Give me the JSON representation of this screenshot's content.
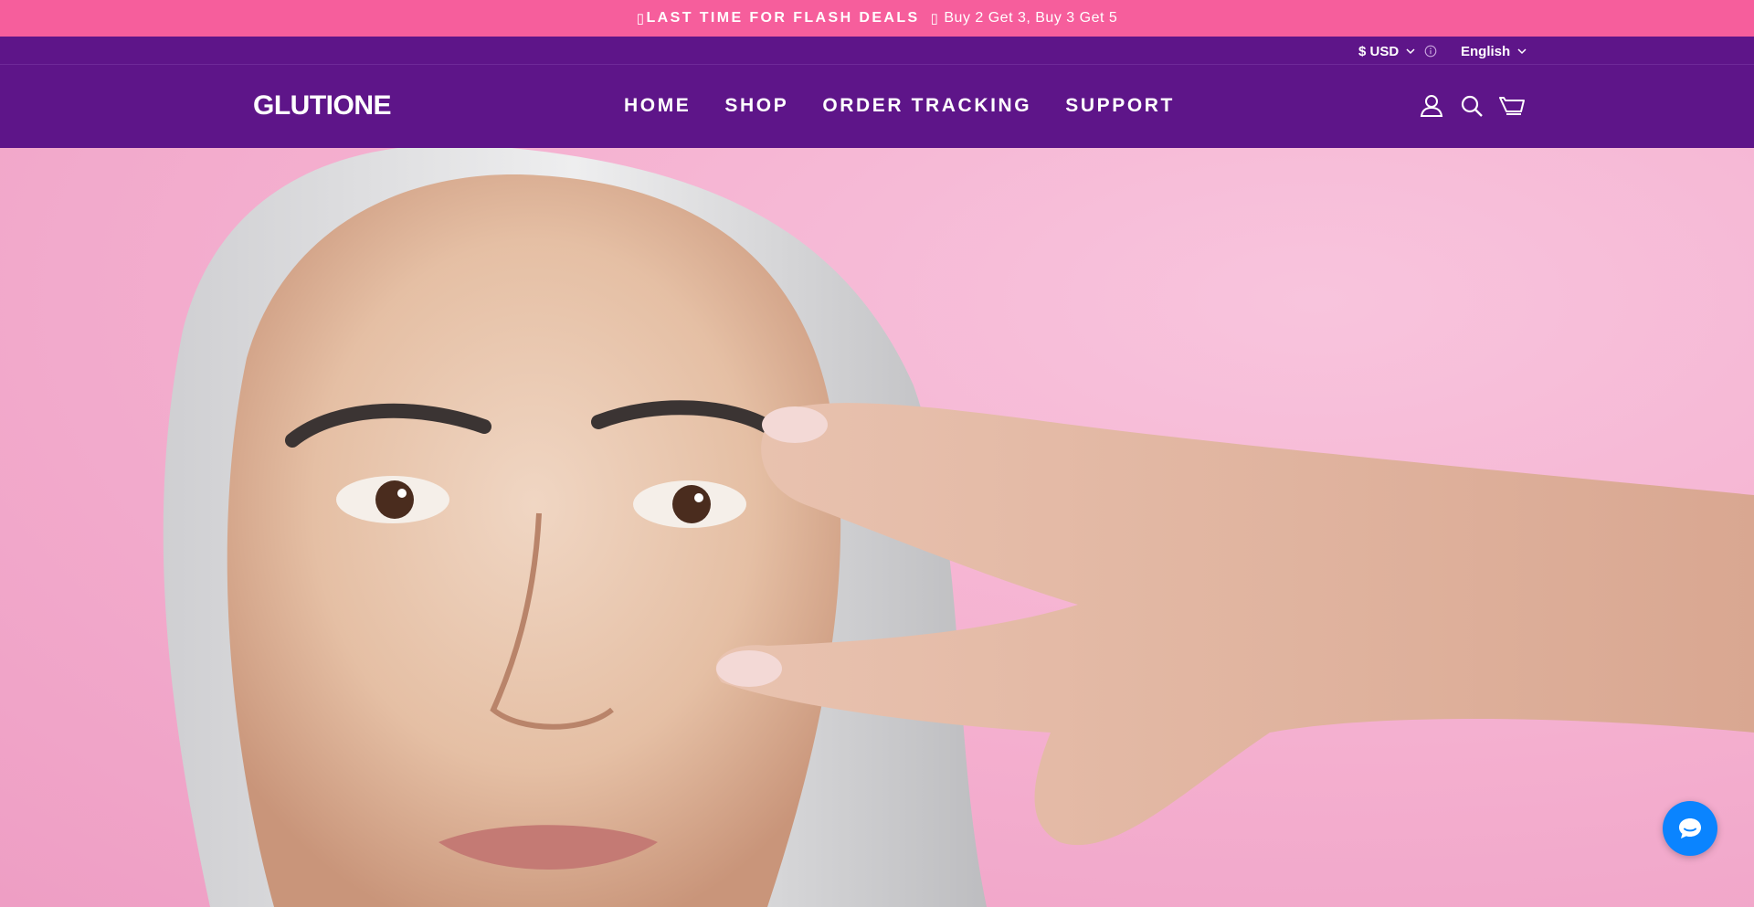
{
  "announcement": {
    "icon_1": "fire-icon",
    "bold_text": "LAST TIME FOR FLASH DEALS",
    "icon_2": "gift-icon",
    "text": "Buy 2 Get 3, Buy 3 Get 5"
  },
  "utility": {
    "currency": "$ USD",
    "language": "English"
  },
  "header": {
    "logo": "GLUTIONE",
    "nav": [
      "HOME",
      "SHOP",
      "ORDER TRACKING",
      "SUPPORT"
    ],
    "icons": [
      "account-icon",
      "search-icon",
      "cart-icon"
    ]
  },
  "hero": {
    "image": "portrait of a gray-haired woman making a peace sign by her eye on a pink background"
  },
  "chat": {
    "icon": "chat-bubble-icon"
  },
  "colors": {
    "announcement_bg": "#f65e9c",
    "header_bg": "#5e1589",
    "hero_bg": "#f5b2d1",
    "chat_bg": "#0a84ff"
  }
}
